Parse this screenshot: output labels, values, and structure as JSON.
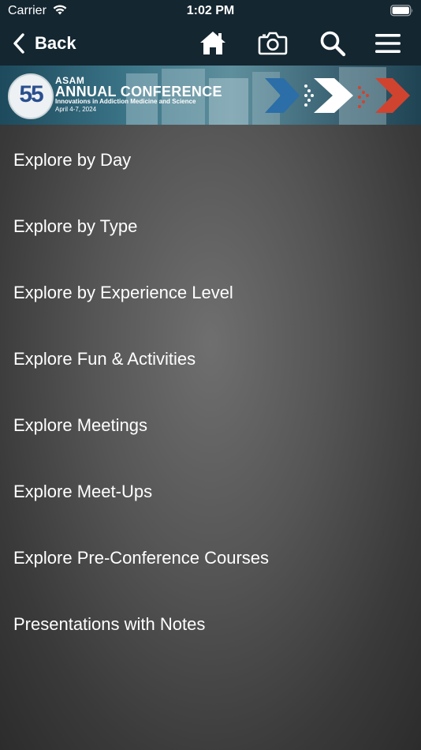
{
  "status_bar": {
    "carrier": "Carrier",
    "time": "1:02 PM"
  },
  "nav": {
    "back_label": "Back",
    "icons": [
      "home-icon",
      "camera-icon",
      "search-icon",
      "hamburger-menu-icon"
    ]
  },
  "banner": {
    "badge": "55",
    "line1": "ASAM",
    "line2": "ANNUAL CONFERENCE",
    "line3": "Innovations in Addiction Medicine and Science",
    "line4": "April 4-7, 2024",
    "colors": {
      "blue": "#2b6ea8",
      "white": "#ffffff",
      "red": "#d0432f"
    }
  },
  "menu": {
    "items": [
      {
        "label": "Explore by Day"
      },
      {
        "label": "Explore by Type"
      },
      {
        "label": "Explore by Experience Level"
      },
      {
        "label": "Explore Fun & Activities"
      },
      {
        "label": "Explore Meetings"
      },
      {
        "label": "Explore Meet-Ups"
      },
      {
        "label": "Explore Pre-Conference Courses"
      },
      {
        "label": "Presentations with Notes"
      }
    ]
  },
  "colors": {
    "header_bg": "#142630",
    "content_bg": "#4f4f4f",
    "text": "#ffffff"
  }
}
